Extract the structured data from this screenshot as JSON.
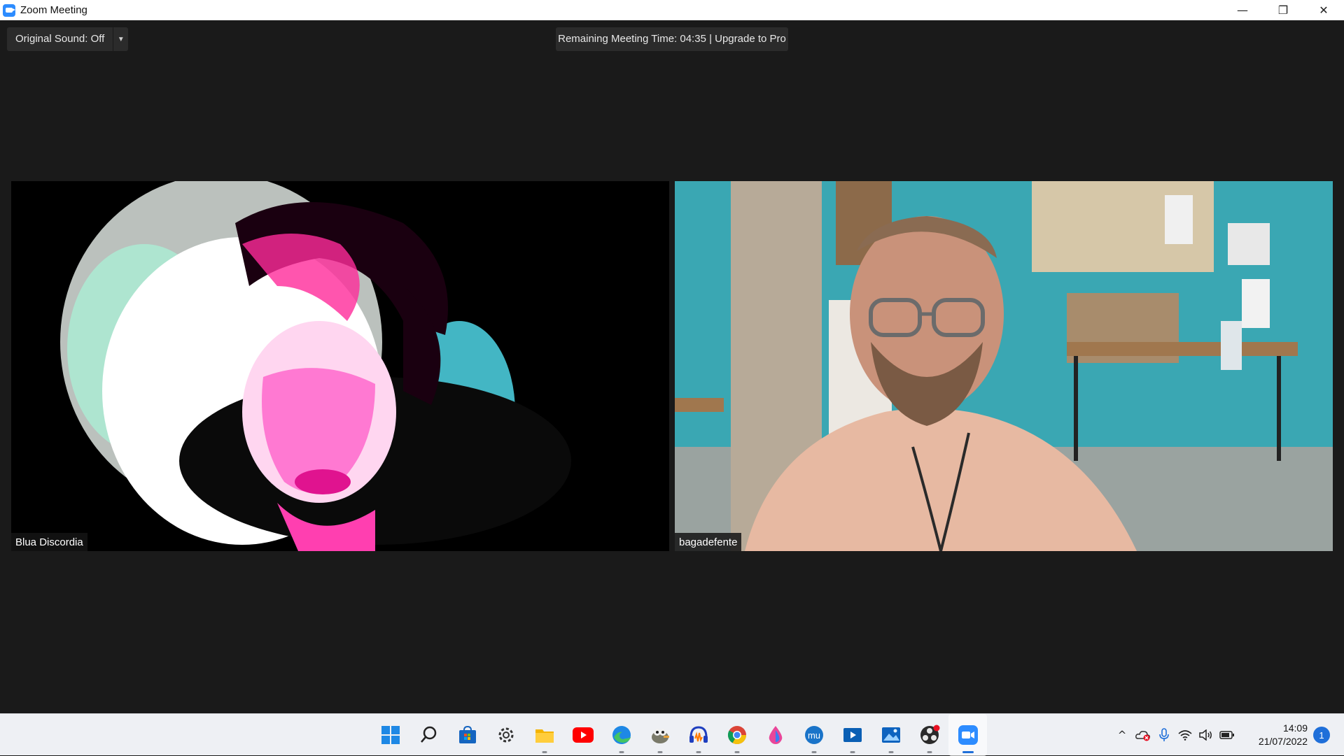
{
  "window": {
    "title": "Zoom Meeting",
    "minimize_glyph": "—",
    "restore_glyph": "❐",
    "close_glyph": "✕"
  },
  "toolbar": {
    "original_sound_label": "Original Sound: Off",
    "dropdown_glyph": "▼",
    "remaining_time_text": "Remaining Meeting Time: 04:35 | Upgrade to Pro"
  },
  "participants": [
    {
      "name": "Blua Discordia"
    },
    {
      "name": "bagadefente"
    }
  ],
  "taskbar": {
    "apps": [
      {
        "icon": "windows-start-icon",
        "running": false
      },
      {
        "icon": "search-icon",
        "running": false
      },
      {
        "icon": "microsoft-store-icon",
        "running": false
      },
      {
        "icon": "settings-gear-icon",
        "running": false
      },
      {
        "icon": "file-explorer-icon",
        "running": true
      },
      {
        "icon": "youtube-icon",
        "running": false
      },
      {
        "icon": "edge-browser-icon",
        "running": true
      },
      {
        "icon": "gimp-icon",
        "running": true
      },
      {
        "icon": "audacity-icon",
        "running": true
      },
      {
        "icon": "chrome-icon",
        "running": true
      },
      {
        "icon": "krita-drop-icon",
        "running": false
      },
      {
        "icon": "musescore-icon",
        "running": true
      },
      {
        "icon": "video-editor-icon",
        "running": true
      },
      {
        "icon": "photos-icon",
        "running": true
      },
      {
        "icon": "obs-studio-icon",
        "running": true
      },
      {
        "icon": "zoom-icon",
        "running": true,
        "active": true
      }
    ],
    "tray": {
      "chevron_glyph": "^",
      "time": "14:09",
      "date": "21/07/2022",
      "notification_count": "1"
    }
  },
  "colors": {
    "background": "#1a1a1a",
    "zoom_blue": "#2D8CFF",
    "taskbar": "#eef0f4",
    "wall_teal": "#3aa7b3"
  }
}
